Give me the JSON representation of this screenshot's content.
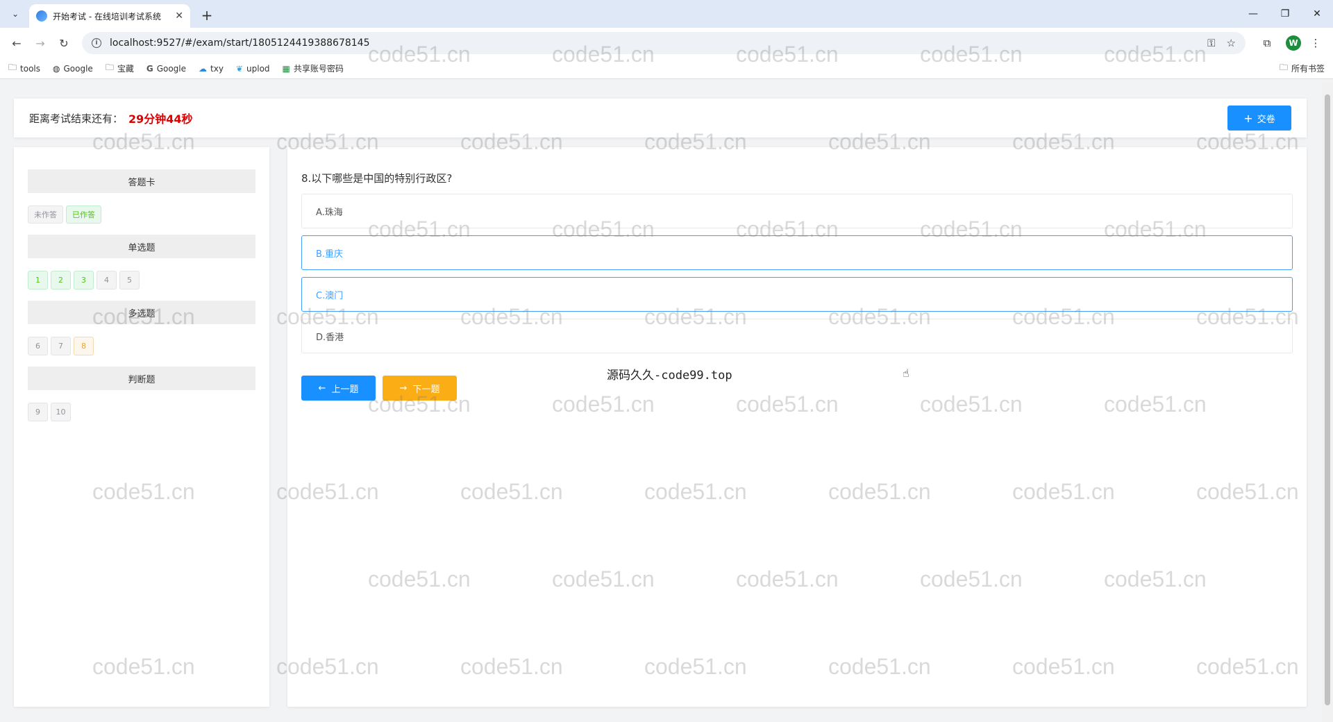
{
  "browser": {
    "tab_title": "开始考试 - 在线培训考试系统",
    "url": "localhost:9527/#/exam/start/1805124419388678145",
    "profile_initial": "W",
    "bookmarks": [
      {
        "label": "tools",
        "icon": "folder-icon"
      },
      {
        "label": "Google",
        "icon": "globe-icon"
      },
      {
        "label": "宝藏",
        "icon": "folder-icon"
      },
      {
        "label": "Google",
        "icon": "google-icon"
      },
      {
        "label": "txy",
        "icon": "cloud-icon"
      },
      {
        "label": "uplod",
        "icon": "bird-icon"
      },
      {
        "label": "共享账号密码",
        "icon": "sheet-icon"
      }
    ],
    "all_bookmarks": "所有书签"
  },
  "exam": {
    "countdown_label": "距离考试结束还有：",
    "countdown_value": "29分钟44秒",
    "submit_label": "交卷"
  },
  "answer_card": {
    "title": "答题卡",
    "legend_undone": "未作答",
    "legend_done": "已作答",
    "sections": [
      {
        "title": "单选题",
        "items": [
          {
            "num": "1",
            "state": "done"
          },
          {
            "num": "2",
            "state": "done"
          },
          {
            "num": "3",
            "state": "done"
          },
          {
            "num": "4",
            "state": "undone"
          },
          {
            "num": "5",
            "state": "undone"
          }
        ]
      },
      {
        "title": "多选题",
        "items": [
          {
            "num": "6",
            "state": "undone"
          },
          {
            "num": "7",
            "state": "undone"
          },
          {
            "num": "8",
            "state": "current"
          }
        ]
      },
      {
        "title": "判断题",
        "items": [
          {
            "num": "9",
            "state": "undone"
          },
          {
            "num": "10",
            "state": "undone"
          }
        ]
      }
    ]
  },
  "question": {
    "text": "8.以下哪些是中国的特别行政区?",
    "options": [
      {
        "label": "A.珠海",
        "selected": false
      },
      {
        "label": "B.重庆",
        "selected": true
      },
      {
        "label": "C.澳门",
        "selected": true
      },
      {
        "label": "D.香港",
        "selected": false
      }
    ],
    "note": "源码久久-code99.top",
    "prev_label": "上一题",
    "next_label": "下一题"
  },
  "watermark_text": "code51.cn"
}
